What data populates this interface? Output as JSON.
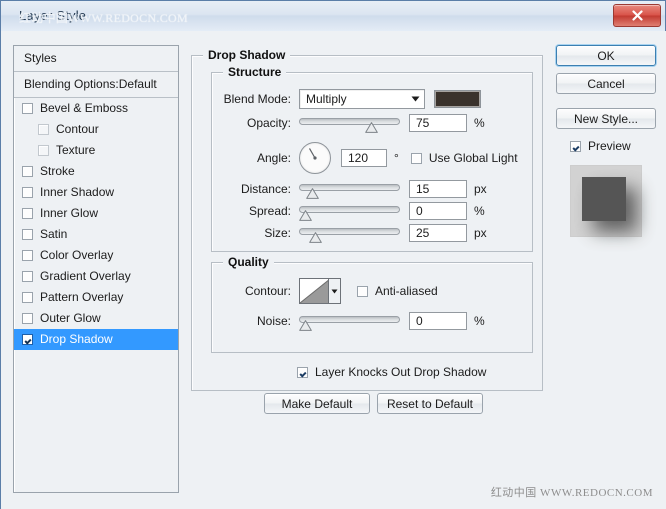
{
  "window": {
    "title": "Layer Style",
    "title_watermark": "红动中国WWW.REDOCN.COM",
    "close_icon": "close-icon",
    "bottom_watermark": "红动中国 WWW.REDOCN.COM"
  },
  "styles_panel": {
    "header": "Styles",
    "blending_options": "Blending Options:Default",
    "items": [
      {
        "label": "Bevel & Emboss",
        "checked": false,
        "sub": false,
        "selected": false
      },
      {
        "label": "Contour",
        "checked": false,
        "sub": true,
        "selected": false
      },
      {
        "label": "Texture",
        "checked": false,
        "sub": true,
        "selected": false
      },
      {
        "label": "Stroke",
        "checked": false,
        "sub": false,
        "selected": false
      },
      {
        "label": "Inner Shadow",
        "checked": false,
        "sub": false,
        "selected": false
      },
      {
        "label": "Inner Glow",
        "checked": false,
        "sub": false,
        "selected": false
      },
      {
        "label": "Satin",
        "checked": false,
        "sub": false,
        "selected": false
      },
      {
        "label": "Color Overlay",
        "checked": false,
        "sub": false,
        "selected": false
      },
      {
        "label": "Gradient Overlay",
        "checked": false,
        "sub": false,
        "selected": false
      },
      {
        "label": "Pattern Overlay",
        "checked": false,
        "sub": false,
        "selected": false
      },
      {
        "label": "Outer Glow",
        "checked": false,
        "sub": false,
        "selected": false
      },
      {
        "label": "Drop Shadow",
        "checked": true,
        "sub": false,
        "selected": true
      }
    ]
  },
  "main": {
    "section_title": "Drop Shadow",
    "structure": {
      "title": "Structure",
      "blend_mode_label": "Blend Mode:",
      "blend_mode_value": "Multiply",
      "shadow_color": "#3a322c",
      "opacity_label": "Opacity:",
      "opacity_value": "75",
      "opacity_unit": "%",
      "opacity_pct": 75,
      "angle_label": "Angle:",
      "angle_value": "120",
      "angle_unit": "°",
      "angle_deg": 120,
      "use_global_light_label": "Use Global Light",
      "use_global_light_checked": false,
      "distance_label": "Distance:",
      "distance_value": "15",
      "distance_unit": "px",
      "distance_pct": 8,
      "spread_label": "Spread:",
      "spread_value": "0",
      "spread_unit": "%",
      "spread_pct": 0,
      "size_label": "Size:",
      "size_value": "25",
      "size_unit": "px",
      "size_pct": 11
    },
    "quality": {
      "title": "Quality",
      "contour_label": "Contour:",
      "anti_aliased_label": "Anti-aliased",
      "anti_aliased_checked": false,
      "noise_label": "Noise:",
      "noise_value": "0",
      "noise_unit": "%",
      "noise_pct": 0
    },
    "knockout": {
      "label": "Layer Knocks Out Drop Shadow",
      "checked": true
    },
    "make_default_label": "Make Default",
    "reset_to_default_label": "Reset to Default"
  },
  "right_buttons": {
    "ok": "OK",
    "cancel": "Cancel",
    "new_style": "New Style...",
    "preview_label": "Preview",
    "preview_checked": true
  }
}
